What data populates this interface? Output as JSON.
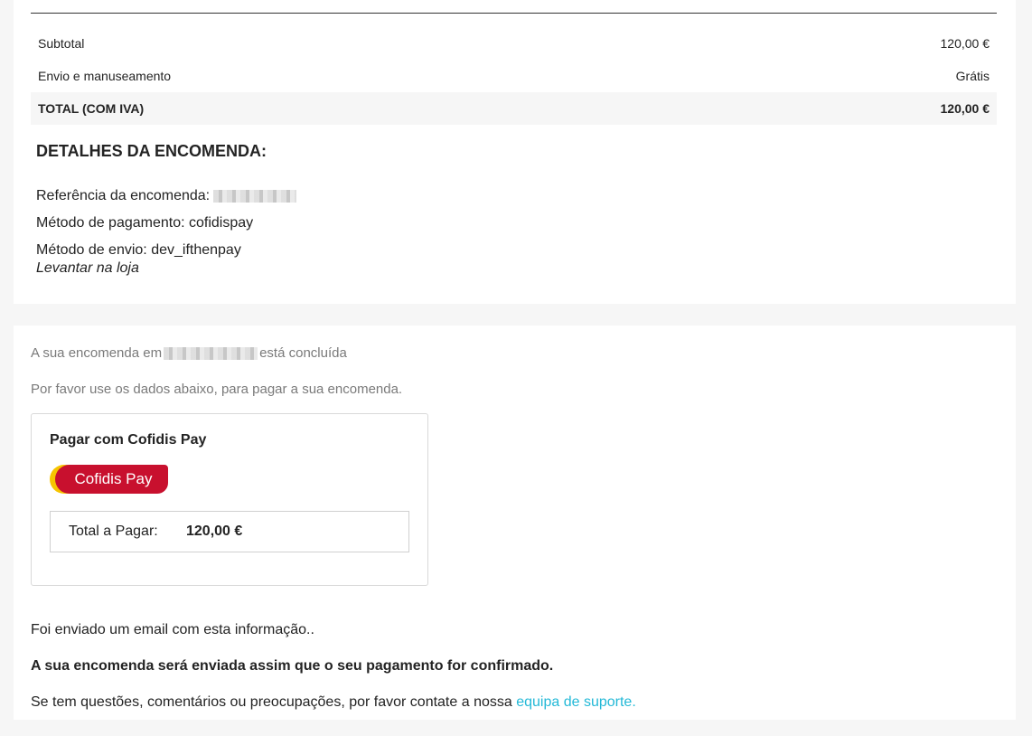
{
  "summary": {
    "subtotal_label": "Subtotal",
    "subtotal_value": "120,00 €",
    "shipping_label": "Envio e manuseamento",
    "shipping_value": "Grátis",
    "total_label": "TOTAL (COM IVA)",
    "total_value": "120,00 €"
  },
  "details": {
    "title": "DETALHES DA ENCOMENDA:",
    "reference_label": "Referência da encomenda:",
    "payment_method": "Método de pagamento: cofidispay",
    "shipping_method": "Método de envio: dev_ifthenpay",
    "pickup_note": "Levantar na loja"
  },
  "confirmation": {
    "order_done_prefix": "A sua encomenda em",
    "order_done_suffix": "está concluída",
    "instructions": "Por favor use os dados abaixo, para pagar a sua encomenda.",
    "paybox_title": "Pagar com Cofidis Pay",
    "logo_text": "Cofidis Pay",
    "total_to_pay_label": "Total a Pagar:",
    "total_to_pay_value": "120,00 €",
    "email_sent": "Foi enviado um email com esta informação..",
    "ship_when_paid": "A sua encomenda será enviada assim que o seu pagamento for confirmado.",
    "contact_prefix": "Se tem questões, comentários ou preocupações, por favor contate a nossa",
    "support_link": "equipa de suporte."
  },
  "colors": {
    "link": "#24b9d7",
    "brand_red": "#c8102e",
    "brand_yellow": "#f6c500"
  }
}
